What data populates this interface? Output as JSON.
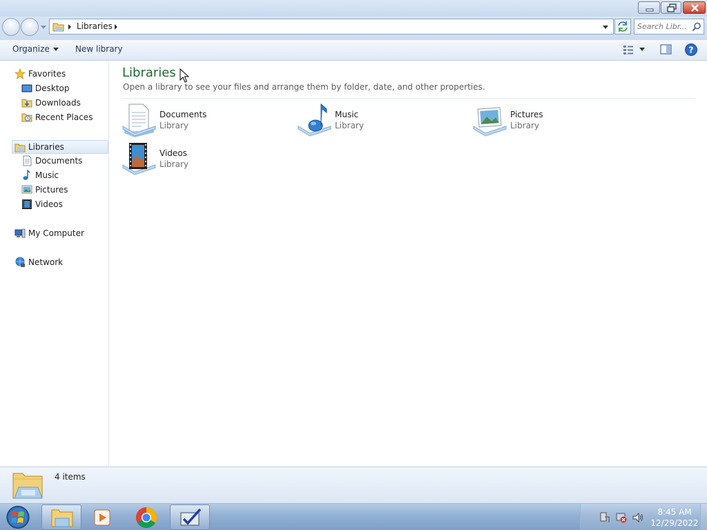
{
  "window": {
    "buttons": [
      "minimize",
      "maximize",
      "close"
    ]
  },
  "address": {
    "path": "Libraries",
    "search_placeholder": "Search Libr..."
  },
  "toolbar": {
    "organize": "Organize",
    "new_library": "New library"
  },
  "sidebar": {
    "favorites": {
      "label": "Favorites",
      "items": [
        "Desktop",
        "Downloads",
        "Recent Places"
      ]
    },
    "libraries": {
      "label": "Libraries",
      "items": [
        "Documents",
        "Music",
        "Pictures",
        "Videos"
      ]
    },
    "computer": "My Computer",
    "network": "Network"
  },
  "content": {
    "title": "Libraries",
    "subtitle": "Open a library to see your files and arrange them by folder, date, and other properties.",
    "libraries": [
      {
        "name": "Documents",
        "type": "Library",
        "icon": "documents-library-icon"
      },
      {
        "name": "Music",
        "type": "Library",
        "icon": "music-library-icon"
      },
      {
        "name": "Pictures",
        "type": "Library",
        "icon": "pictures-library-icon"
      },
      {
        "name": "Videos",
        "type": "Library",
        "icon": "videos-library-icon"
      }
    ]
  },
  "details": {
    "count": "4 items"
  },
  "taskbar": {
    "apps": [
      "file-explorer",
      "media-player",
      "chrome",
      "app"
    ],
    "time": "8:45 AM",
    "date": "12/29/2022"
  },
  "colors": {
    "title_green": "#1e6b31",
    "accent_blue": "#1e395b"
  }
}
